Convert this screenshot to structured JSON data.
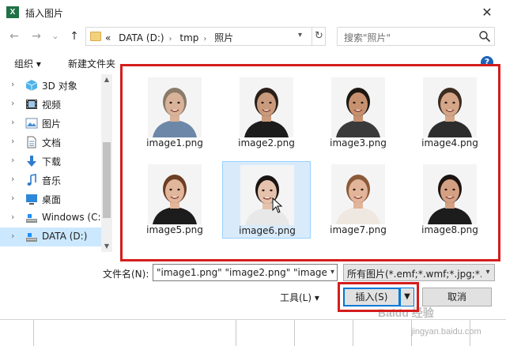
{
  "window": {
    "title": "插入图片",
    "app_icon": "X",
    "close": "✕"
  },
  "nav": {
    "back": "←",
    "forward": "→",
    "recent": "⌄",
    "up": "↑",
    "breadcrumbs": [
      "«",
      "DATA (D:)",
      "tmp",
      "照片"
    ],
    "search_placeholder": "搜索\"照片\""
  },
  "toolbar": {
    "organize": "组织 ▾",
    "new_folder": "新建文件夹",
    "help": "?"
  },
  "sidebar": {
    "items": [
      {
        "label": "3D 对象",
        "icon": "cube-3d-icon"
      },
      {
        "label": "视频",
        "icon": "video-icon"
      },
      {
        "label": "图片",
        "icon": "pictures-icon"
      },
      {
        "label": "文档",
        "icon": "documents-icon"
      },
      {
        "label": "下载",
        "icon": "download-icon"
      },
      {
        "label": "音乐",
        "icon": "music-icon"
      },
      {
        "label": "桌面",
        "icon": "desktop-icon"
      },
      {
        "label": "Windows (C:)",
        "icon": "drive-icon"
      },
      {
        "label": "DATA (D:)",
        "icon": "drive-icon",
        "selected": true
      }
    ]
  },
  "files": [
    {
      "name": "image1.png",
      "selected": false,
      "skin": "#d8b39a",
      "hair": "#8a7b6a",
      "shirt": "#6d87a8"
    },
    {
      "name": "image2.png",
      "selected": false,
      "skin": "#c99a7c",
      "hair": "#2a1f1a",
      "shirt": "#1c1c1c"
    },
    {
      "name": "image3.png",
      "selected": false,
      "skin": "#c7916f",
      "hair": "#1d1712",
      "shirt": "#3a3a3a"
    },
    {
      "name": "image4.png",
      "selected": false,
      "skin": "#d4a587",
      "hair": "#3b2b20",
      "shirt": "#2d2d2d"
    },
    {
      "name": "image5.png",
      "selected": false,
      "skin": "#e2b69b",
      "hair": "#6d3e24",
      "shirt": "#1c1c1c"
    },
    {
      "name": "image6.png",
      "selected": true,
      "skin": "#e6c2ad",
      "hair": "#1a1512",
      "shirt": "#e8e8e8"
    },
    {
      "name": "image7.png",
      "selected": false,
      "skin": "#e2b49a",
      "hair": "#8c5a3a",
      "shirt": "#efe8e0"
    },
    {
      "name": "image8.png",
      "selected": false,
      "skin": "#d4a083",
      "hair": "#1b1411",
      "shirt": "#1c1c1c"
    }
  ],
  "bottom": {
    "filename_label": "文件名(N):",
    "filename_value": "\"image1.png\" \"image2.png\" \"image",
    "filetype_value": "所有图片(*.emf;*.wmf;*.jpg;*.jp",
    "tools_label": "工具(L)  ▾",
    "insert_label": "插入(S)",
    "cancel_label": "取消"
  },
  "watermark": {
    "brand": "Baidu 经验",
    "url": "jingyan.baidu.com"
  },
  "colors": {
    "highlight_frame": "#d51d1d",
    "selection": "#cce8ff",
    "accent": "#0078d7"
  }
}
